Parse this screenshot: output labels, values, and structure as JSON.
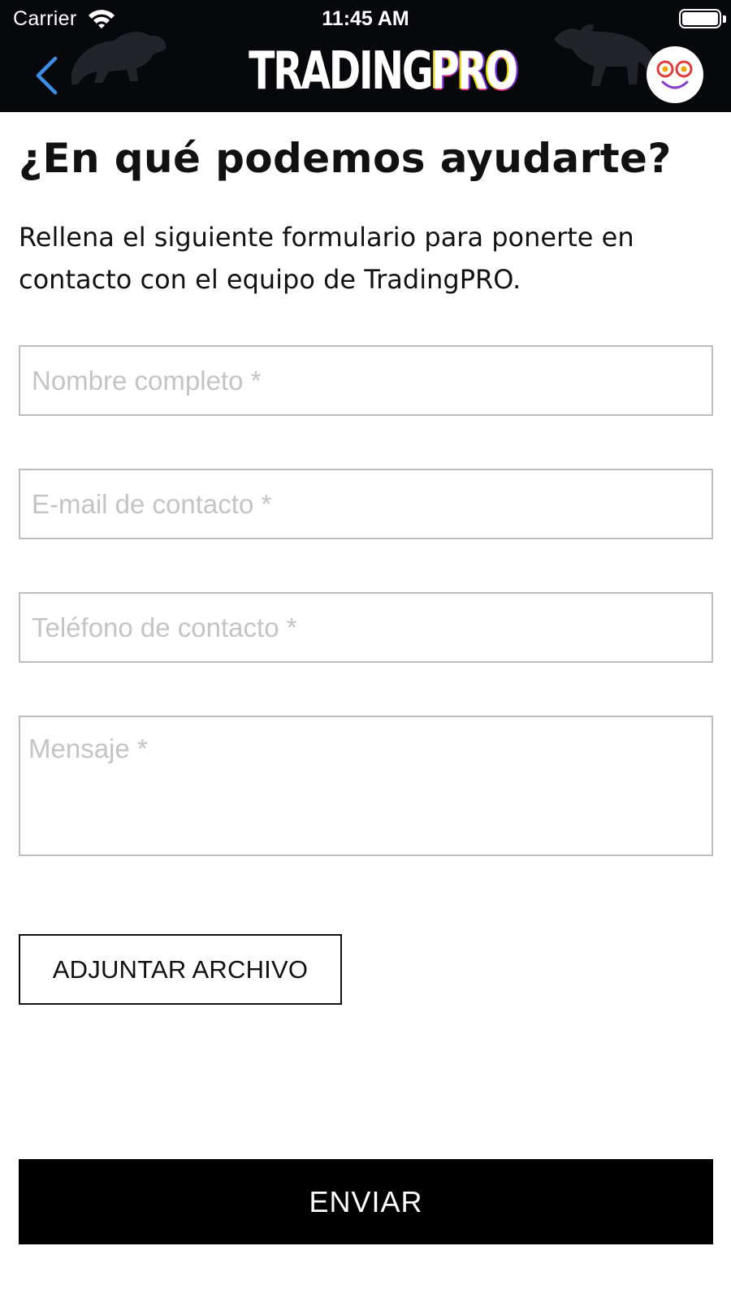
{
  "status_bar": {
    "carrier": "Carrier",
    "time": "11:45 AM",
    "wifi_icon": "wifi-icon",
    "battery_icon": "battery-icon"
  },
  "header": {
    "logo_part1": "TRADING",
    "logo_part2": "PRO",
    "back_icon": "chevron-left-icon",
    "avatar_icon": "smiley-face-icon",
    "colors": {
      "background": "#07080b",
      "back_chevron": "#3a8ee6"
    }
  },
  "page": {
    "title": "¿En qué podemos ayudarte?",
    "description": "Rellena el siguiente formulario para ponerte en contacto con el equipo de TradingPRO."
  },
  "form": {
    "name_placeholder": "Nombre completo *",
    "email_placeholder": "E-mail de contacto *",
    "phone_placeholder": "Teléfono de contacto *",
    "message_placeholder": "Mensaje *",
    "attach_label": "ADJUNTAR ARCHIVO",
    "submit_label": "ENVIAR"
  }
}
